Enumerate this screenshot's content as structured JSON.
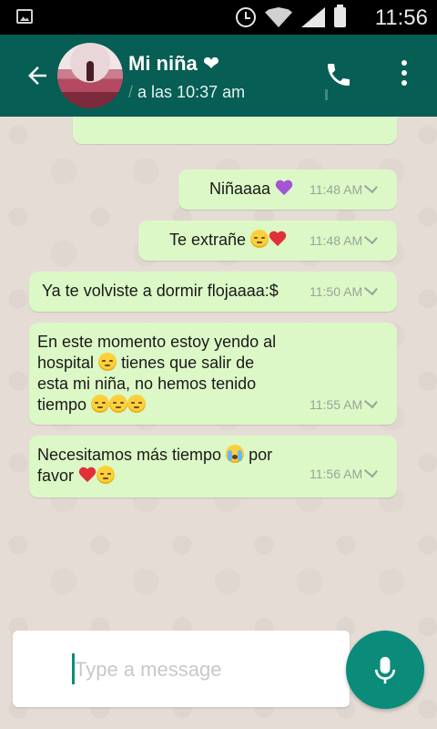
{
  "status_bar": {
    "time": "11:56",
    "icons": [
      "image-icon",
      "alarm-clock-icon",
      "wifi-icon",
      "signal-icon",
      "battery-icon"
    ]
  },
  "header": {
    "contact_name": "Mi niña ❤",
    "last_seen_prefix": "/",
    "last_seen": "a las 10:37 am",
    "icons": [
      "back-arrow-icon",
      "avatar",
      "phone-icon",
      "more-vert-icon"
    ],
    "color": "#075e54"
  },
  "messages": [
    {
      "text": "Niñaaaa",
      "emojis": [
        "purple-heart"
      ],
      "time": "11:48 AM",
      "outgoing": true
    },
    {
      "text": "Te extrañe",
      "emojis": [
        "pensive-face",
        "red-heart"
      ],
      "time": "11:48 AM",
      "outgoing": true
    },
    {
      "text": "Ya te volviste a dormir flojaaaa:$",
      "emojis": [],
      "time": "11:50 AM",
      "outgoing": true
    },
    {
      "text_lines": [
        "En este momento estoy yendo al",
        "hospital",
        "tienes que salir de",
        "esta mi niña, no hemos tenido",
        "tiempo"
      ],
      "emojis": [
        "pensive-face",
        "pensive-face",
        "pensive-face",
        "pensive-face"
      ],
      "time": "11:55 AM",
      "outgoing": true
    },
    {
      "text_lines": [
        "Necesitamos más tiempo",
        "por",
        "favor"
      ],
      "emojis": [
        "crying-face",
        "red-heart",
        "pensive-face"
      ],
      "time": "11:56 AM",
      "outgoing": true
    }
  ],
  "input": {
    "placeholder": "Type a message"
  },
  "colors": {
    "outgoing_bubble": "#dcf8c6",
    "chat_background": "#e5ddd5",
    "accent": "#0b8c7a"
  }
}
